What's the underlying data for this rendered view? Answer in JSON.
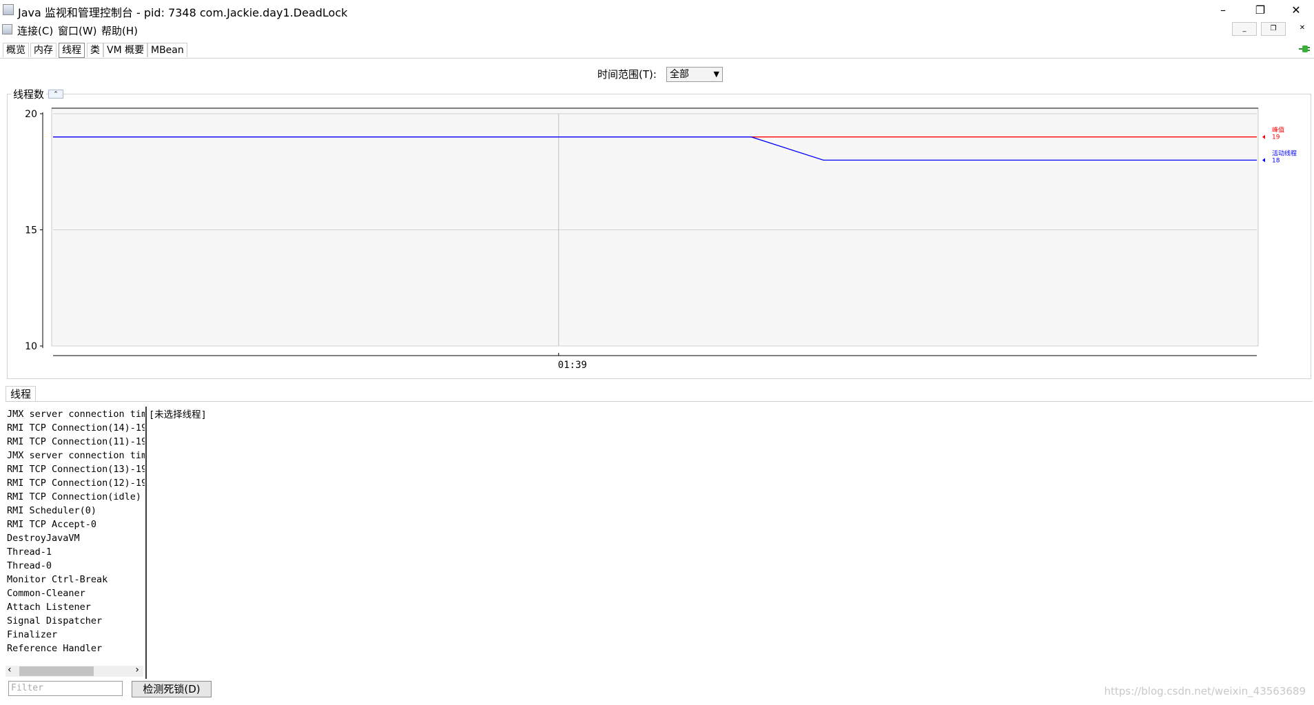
{
  "window": {
    "title": "Java 监视和管理控制台 - pid: 7348 com.Jackie.day1.DeadLock",
    "minimize": "–",
    "restore": "❐",
    "close": "✕"
  },
  "menu": {
    "items": [
      "连接(C)",
      "窗口(W)",
      "帮助(H)"
    ]
  },
  "tabs": [
    "概览",
    "内存",
    "线程",
    "类",
    "VM 概要",
    "MBean"
  ],
  "active_tab": "线程",
  "time_range": {
    "label": "时间范围(T):",
    "value": "全部"
  },
  "chart_panel": {
    "title": "线程数",
    "collapse_icon": "chevron-up-icon"
  },
  "chart_data": {
    "type": "line",
    "ylim": [
      10,
      20
    ],
    "yticks": [
      "20",
      "15",
      "10"
    ],
    "xticks": [
      "01:39"
    ],
    "series": [
      {
        "name": "峰值",
        "color": "#ff0000",
        "points": [
          [
            0,
            19
          ],
          [
            0.58,
            19
          ],
          [
            1,
            19
          ]
        ],
        "last_value": "19"
      },
      {
        "name": "活动线程",
        "color": "#0000ff",
        "points": [
          [
            0,
            19
          ],
          [
            0.58,
            19
          ],
          [
            0.64,
            18
          ],
          [
            1,
            18
          ]
        ],
        "last_value": "18"
      }
    ]
  },
  "threads_panel": {
    "tab": "线程",
    "threads": [
      "JMX server connection tim",
      "RMI TCP Connection(14)-19",
      "RMI TCP Connection(11)-19",
      "JMX server connection tim",
      "RMI TCP Connection(13)-19",
      "RMI TCP Connection(12)-19",
      "RMI TCP Connection(idle)",
      "RMI Scheduler(0)",
      "RMI TCP Accept-0",
      "DestroyJavaVM",
      "Thread-1",
      "Thread-0",
      "Monitor Ctrl-Break",
      "Common-Cleaner",
      "Attach Listener",
      "Signal Dispatcher",
      "Finalizer",
      "Reference Handler"
    ],
    "detail_placeholder": "[未选择线程]",
    "filter_placeholder": "Filter",
    "detect_deadlock_label": "检测死锁(D)"
  },
  "watermark": "https://blog.csdn.net/weixin_43563689"
}
